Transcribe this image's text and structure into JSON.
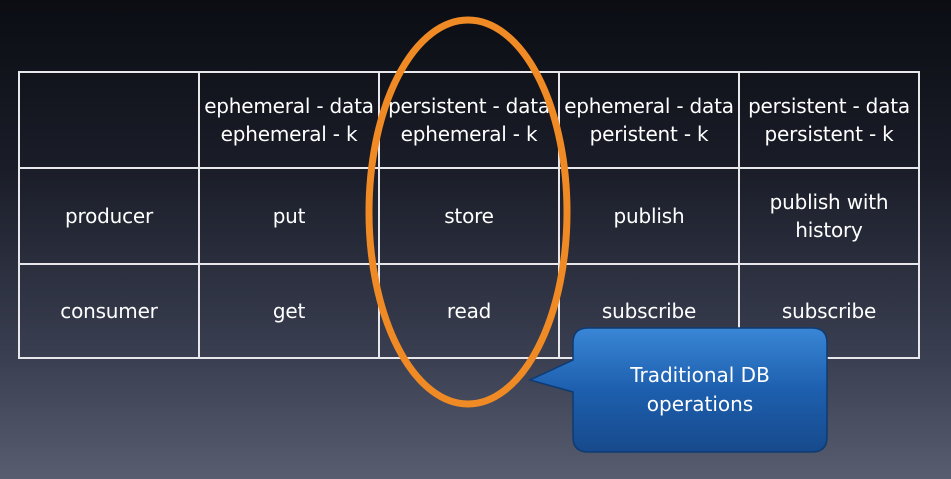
{
  "table": {
    "header": [
      [
        ""
      ],
      [
        "ephemeral - data",
        "ephemeral - k"
      ],
      [
        "persistent - data",
        "ephemeral - k"
      ],
      [
        "ephemeral - data",
        "peristent - k"
      ],
      [
        "persistent - data",
        "persistent - k"
      ]
    ],
    "rows": [
      {
        "label": "producer",
        "cells": [
          [
            "put"
          ],
          [
            "store"
          ],
          [
            "publish"
          ],
          [
            "publish with",
            "history"
          ]
        ]
      },
      {
        "label": "consumer",
        "cells": [
          [
            "get"
          ],
          [
            "read"
          ],
          [
            "subscribe"
          ],
          [
            "subscribe"
          ]
        ]
      }
    ]
  },
  "callout": {
    "lines": [
      "Traditional DB",
      "operations"
    ]
  },
  "colors": {
    "highlight_ellipse": "#f08a24",
    "callout_fill": "#1d5fae",
    "grid_line": "#e8e8ec",
    "text": "#ffffff"
  }
}
